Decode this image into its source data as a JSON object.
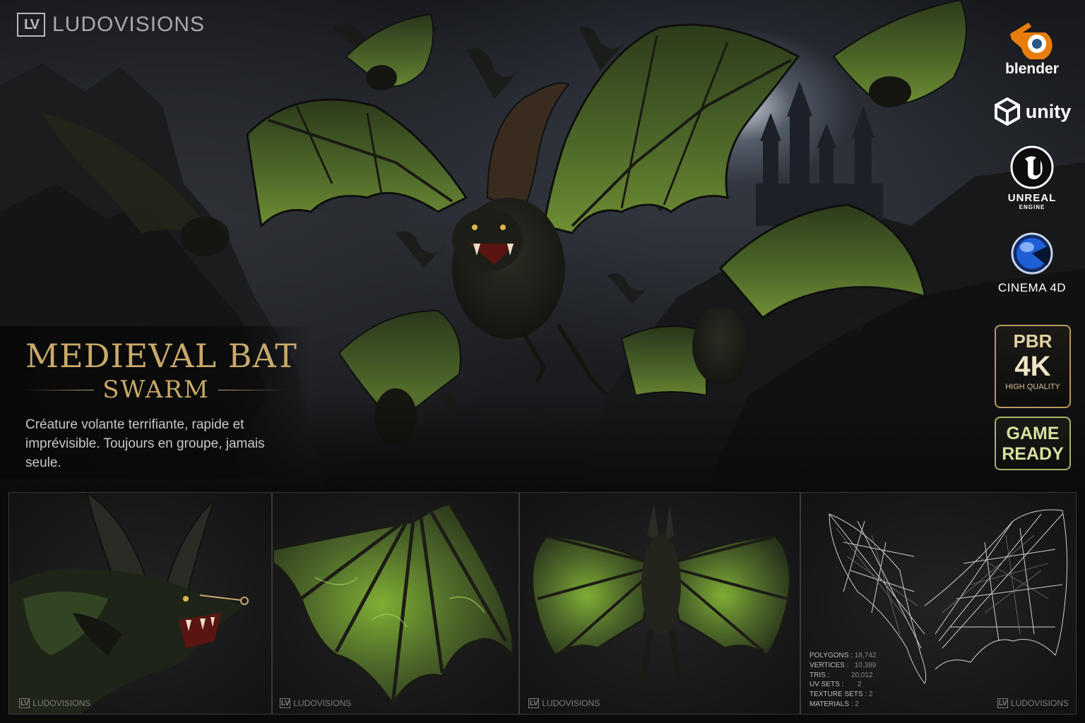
{
  "brand": {
    "name": "LUDOVISIONS",
    "mark": "LV"
  },
  "title": {
    "main": "MEDIEVAL BAT",
    "sub": "SWARM",
    "description": "Créature volante terrifiante, rapide et imprévisible. Toujours en groupe, jamais seule."
  },
  "engines": [
    {
      "name": "blender",
      "icon": "blender-icon"
    },
    {
      "name": "unity",
      "icon": "unity-icon"
    },
    {
      "name": "UNREAL",
      "sub": "ENGINE",
      "icon": "unreal-icon"
    },
    {
      "name": "CINEMA 4D",
      "icon": "cinema4d-icon"
    }
  ],
  "badges": {
    "pbr": {
      "line1": "PBR",
      "line2": "4K",
      "line3": "HIGH QUALITY"
    },
    "game": {
      "line1": "GAME",
      "line2": "READY"
    }
  },
  "thumbnails": [
    {
      "watermark": "LUDOVISIONS",
      "mark": "LV"
    },
    {
      "watermark": "LUDOVISIONS",
      "mark": "LV"
    },
    {
      "watermark": "LUDOVISIONS",
      "mark": "LV"
    },
    {
      "watermark": "LUDOVISIONS",
      "mark": "LV"
    }
  ],
  "stats": [
    {
      "label": "POLYGONS :",
      "value": "18,742"
    },
    {
      "label": "VERTICES :",
      "value": "10,389"
    },
    {
      "label": "TRIS :",
      "value": "20,012"
    },
    {
      "label": "UV SETS :",
      "value": "2"
    },
    {
      "label": "TEXTURE SETS :",
      "value": "2"
    },
    {
      "label": "MATERIALS :",
      "value": "2"
    }
  ],
  "colors": {
    "gold": "#c9a96a",
    "wing_green": "#4f6a2a",
    "wing_highlight": "#8fbf3c",
    "blender_orange": "#e87d0d",
    "c4d_blue": "#1f5fd6",
    "game_ready_green": "#a9b36a"
  }
}
